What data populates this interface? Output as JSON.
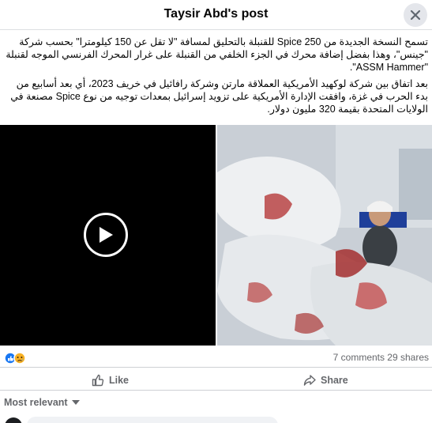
{
  "header": {
    "title": "Taysir Abd's post"
  },
  "post": {
    "paragraphs": [
      "تسمح النسخة الجديدة من Spice 250 للقنبلة بالتحليق لمسافة \"لا تقل عن 150 كيلومترا\" بحسب شركة \"جينس\"، وهذا بفضل إضافة محرك في الجزء الخلفي من القنبلة على غرار المحرك الفرنسي الموجه لقنبلة \"ASSM Hammer\".",
      "بعد اتفاق بين شركة لوكهيد الأمريكية العملاقة مارتن وشركة رافائيل في خريف 2023، أي بعد أسابيع من بدء الحرب في غزة، وافقت الإدارة الأمريكية على تزويد إسرائيل بمعدات توجيه من نوع Spice مصنعة في الولايات المتحدة بقيمة 320 مليون دولار."
    ]
  },
  "stats": {
    "comments": "7 comments",
    "shares": "29 shares"
  },
  "actions": {
    "like_label": "Like",
    "share_label": "Share"
  },
  "comments_section": {
    "sort_label": "Most relevant"
  },
  "colors": {
    "accent": "#1877f2",
    "muted_text": "#65676b",
    "divider": "#ced0d4"
  },
  "icons": [
    "close-icon",
    "play-icon",
    "like-reaction-icon",
    "sad-reaction-icon",
    "thumbs-up-icon",
    "share-arrow-icon",
    "caret-down-icon"
  ]
}
